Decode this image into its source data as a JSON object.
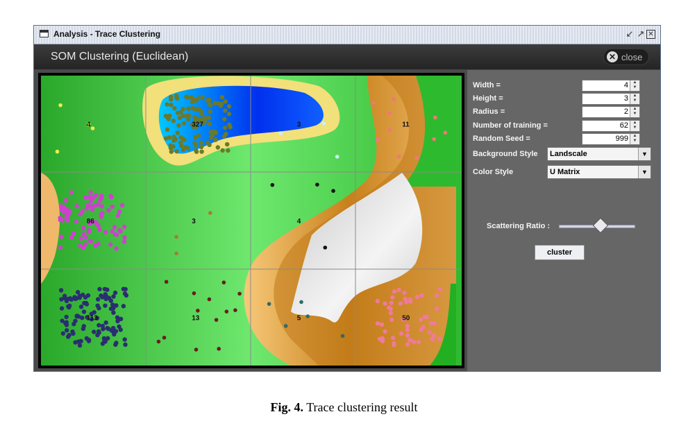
{
  "window": {
    "title": "Analysis - Trace Clustering",
    "minimize_icon": "minimize-icon",
    "maximize_icon": "maximize-icon",
    "close_icon": "close-window-icon"
  },
  "header": {
    "heading": "SOM Clustering (Euclidean)",
    "close_label": "close"
  },
  "map": {
    "grid_columns": 4,
    "grid_rows": 3,
    "cell_counts": [
      "4",
      "327",
      "3",
      "11",
      "86",
      "3",
      "4",
      "",
      "113",
      "13",
      "5",
      "50"
    ],
    "colors": {
      "lowland": "#22bb22",
      "highland": "#d18a1f",
      "water": "#0040ff",
      "snow": "#e6e6e6"
    }
  },
  "panel": {
    "width_label": "Width =",
    "width_value": "4",
    "height_label": "Height =",
    "height_value": "3",
    "radius_label": "Radius =",
    "radius_value": "2",
    "training_label": "Number of training =",
    "training_value": "62",
    "seed_label": "Random Seed =",
    "seed_value": "999",
    "background_style_label": "Background Style",
    "background_style_value": "Landscale",
    "color_style_label": "Color Style",
    "color_style_value": "U Matrix",
    "scattering_label": "Scattering Ratio :",
    "scattering_ratio": 0.55,
    "cluster_label": "cluster"
  },
  "caption": {
    "fig_label": "Fig. 4.",
    "text": "Trace clustering result"
  }
}
